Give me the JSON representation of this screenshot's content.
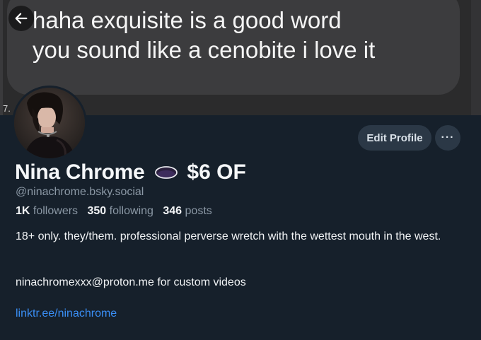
{
  "banner": {
    "message_lines": [
      "haha exquisite is a good word",
      "you sound like a cenobite i love it"
    ],
    "timestamp_fragment": "7."
  },
  "header": {
    "back_icon": "arrow-left-icon"
  },
  "profile": {
    "display_name": "Nina Chrome",
    "emoji_icon": "dark-oval-emoji",
    "name_suffix": "$6 OF",
    "handle": "@ninachrome.bsky.social",
    "followers_count": "1K",
    "followers_label": "followers",
    "following_count": "350",
    "following_label": "following",
    "posts_count": "346",
    "posts_label": "posts",
    "bio": "18+ only. they/them. professional perverse wretch with the wettest mouth in the west.",
    "contact_line": "ninachromexxx@proton.me for custom videos",
    "link_text": "linktr.ee/ninachrome"
  },
  "actions": {
    "edit_profile_label": "Edit Profile",
    "more_label": "···"
  },
  "colors": {
    "page_bg": "#16202b",
    "button_bg": "#2b3846",
    "link": "#3a8ef5",
    "muted_text": "#8b98a5"
  }
}
